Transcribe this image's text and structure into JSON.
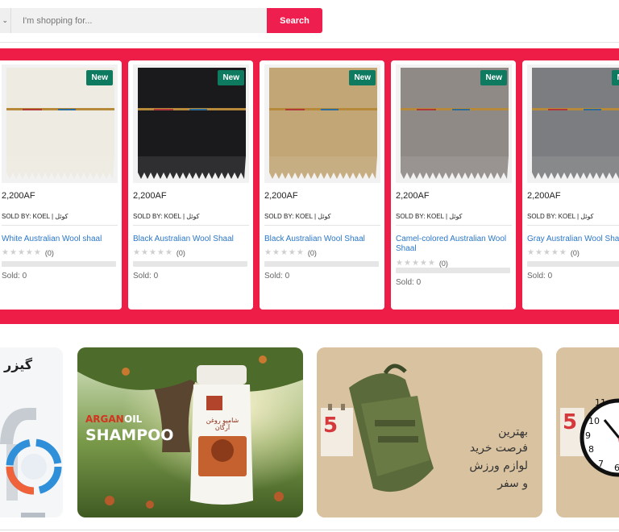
{
  "search": {
    "category_icon": "chevron-down-icon",
    "placeholder": "I'm shopping for...",
    "button_label": "Search"
  },
  "products": [
    {
      "badge": "New",
      "price": "2,200AF",
      "sold_by_label": "SOLD BY: KOEL | ",
      "store_name": "کوئل",
      "title": "White Australian Wool shaal",
      "rating_count": "(0)",
      "sold": "Sold: 0",
      "fabric_color": "#eeebe2"
    },
    {
      "badge": "New",
      "price": "2,200AF",
      "sold_by_label": "SOLD BY: KOEL | ",
      "store_name": "کوئل",
      "title": "Black Australian Wool Shaal",
      "rating_count": "(0)",
      "sold": "Sold: 0",
      "fabric_color": "#1a1a1c"
    },
    {
      "badge": "New",
      "price": "2,200AF",
      "sold_by_label": "SOLD BY: KOEL | ",
      "store_name": "کوئل",
      "title": "Black Australian Wool Shaal",
      "rating_count": "(0)",
      "sold": "Sold: 0",
      "fabric_color": "#c2a676"
    },
    {
      "badge": "New",
      "price": "2,200AF",
      "sold_by_label": "SOLD BY: KOEL | ",
      "store_name": "کوئل",
      "title": "Camel-colored Australian Wool Shaal",
      "rating_count": "(0)",
      "sold": "Sold: 0",
      "fabric_color": "#8f8a86"
    },
    {
      "badge": "New",
      "price": "2,200AF",
      "sold_by_label": "SOLD BY: KOEL | ",
      "store_name": "کوئل",
      "title": "Gray Australian Wool Shaal",
      "rating_count": "(0)",
      "sold": "Sold: 0",
      "fabric_color": "#7c7d80"
    }
  ],
  "banners": {
    "heater": {
      "text": "گیزر آ"
    },
    "shampoo": {
      "word1": "ARGAN",
      "word2": "OIL",
      "word3": "SHAMPOO",
      "bottle_line1": "شامپو روغن آرگان"
    },
    "backpack": {
      "day": "5",
      "line1": "بهترین",
      "line2": "فرصت خرید",
      "line3": "لوازم ورزش",
      "line4": "و سفر"
    },
    "clock": {
      "day": "5"
    }
  },
  "colors": {
    "accent": "#ee1d48",
    "badge": "#0e7a60",
    "link": "#2b77c9"
  }
}
